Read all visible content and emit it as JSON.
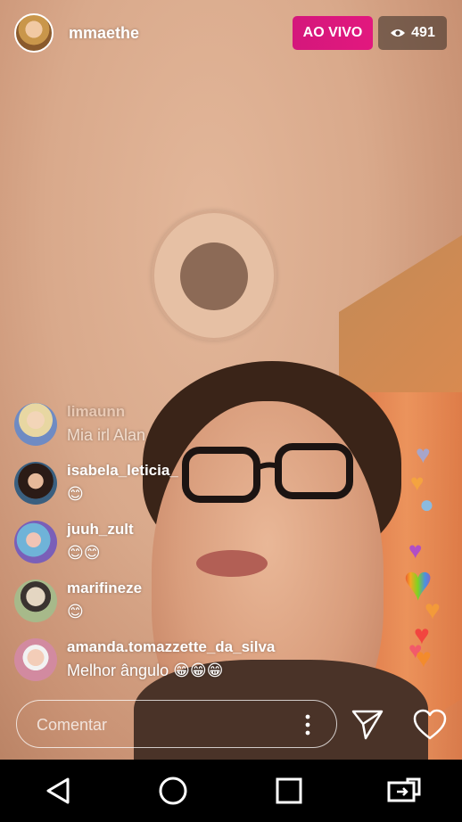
{
  "header": {
    "host_name": "mmaethe",
    "live_label": "AO VIVO",
    "viewer_count": "491",
    "viewer_icon": "eye-icon"
  },
  "comments": [
    {
      "username": "limaunn",
      "text": "Mia irl Alan",
      "faded": true
    },
    {
      "username": "isabela_leticia_",
      "text": "😊"
    },
    {
      "username": "juuh_zult",
      "text": "😊😊"
    },
    {
      "username": "marifineze",
      "text": "😊"
    },
    {
      "username": "amanda.tomazzette_da_silva",
      "text": "Melhor ângulo 😁😁😁"
    }
  ],
  "footer": {
    "comment_placeholder": "Comentar",
    "more_icon": "more-vertical-icon",
    "send_icon": "send-icon",
    "like_icon": "heart-outline-icon"
  },
  "navbar": {
    "back_icon": "back-triangle-icon",
    "home_icon": "home-circle-icon",
    "recents_icon": "recents-square-icon",
    "switch_icon": "switch-apps-icon"
  },
  "colors": {
    "live_badge": "#e2187e",
    "heart_colors": [
      "#a7a5c9",
      "#f4a340",
      "#8bbbe0",
      "#b14fc5",
      "#f2643f",
      "#f38b2d"
    ]
  }
}
